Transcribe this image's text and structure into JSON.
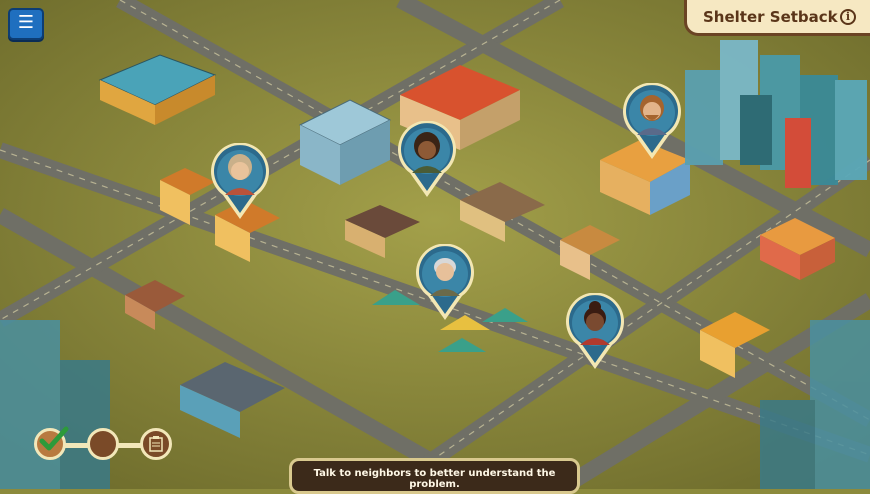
{
  "title": "Shelter Setback",
  "icons": {
    "menu": "hamburger-menu-icon",
    "info": "info-icon"
  },
  "objective": "Talk to neighbors to better understand the problem.",
  "progress_steps": [
    {
      "name": "step-complete",
      "icon": "checkmark-icon",
      "state": "complete"
    },
    {
      "name": "step-current",
      "icon": "empty-circle-icon",
      "state": "current"
    },
    {
      "name": "step-locked",
      "icon": "clipboard-icon",
      "state": "locked"
    }
  ],
  "neighbors": [
    {
      "name": "neighbor-pin-woman-scarf",
      "hair": "#c9b08a",
      "skin": "#e9c39b",
      "shirt": "#b8523a"
    },
    {
      "name": "neighbor-pin-girl-braids",
      "hair": "#3a2416",
      "skin": "#8d5a36",
      "shirt": "#4a5c36"
    },
    {
      "name": "neighbor-pin-bearded-man",
      "hair": "#a5642e",
      "skin": "#e3b48a",
      "shirt": "#5a6a8a"
    },
    {
      "name": "neighbor-pin-older-man",
      "hair": "#d8d8d8",
      "skin": "#e7c09a",
      "shirt": "#6b6a4a"
    },
    {
      "name": "neighbor-pin-woman-bun",
      "hair": "#3a1c12",
      "skin": "#7a4a30",
      "shirt": "#b03a2e"
    }
  ],
  "colors": {
    "grass": "#8c8a3c",
    "road": "#7a7a72",
    "panel": "#f6e8c2",
    "panel_border": "#6b4424",
    "pin_fill": "#2c6a8c",
    "pin_border": "#f3e7b3"
  }
}
